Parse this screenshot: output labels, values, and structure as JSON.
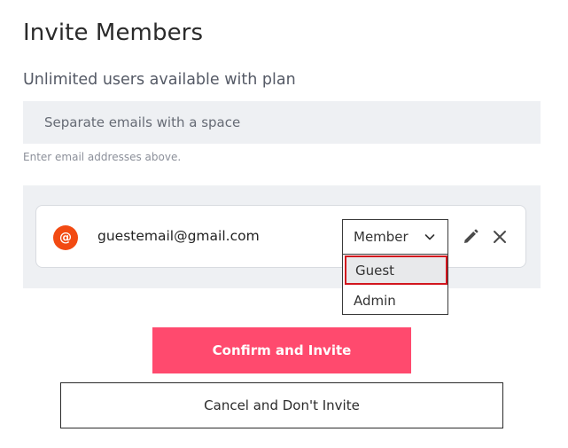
{
  "header": {
    "title": "Invite Members",
    "subtitle": "Unlimited users available with plan"
  },
  "email_input": {
    "placeholder": "Separate emails with a space",
    "value": "",
    "hint": "Enter email addresses above."
  },
  "invitee": {
    "avatar_glyph": "@",
    "avatar_color": "#f24a12",
    "email": "guestemail@gmail.com",
    "role": "Member",
    "icons": [
      "chevron-down-icon",
      "pencil-icon",
      "close-icon"
    ]
  },
  "role_dropdown": {
    "options": [
      "Guest",
      "Admin"
    ],
    "highlighted": "Guest"
  },
  "actions": {
    "confirm_label": "Confirm and Invite",
    "cancel_label": "Cancel and Don't Invite"
  },
  "colors": {
    "accent": "#ff4a6e",
    "highlight_border": "#d2161e",
    "panel_bg": "#eef0f3"
  }
}
